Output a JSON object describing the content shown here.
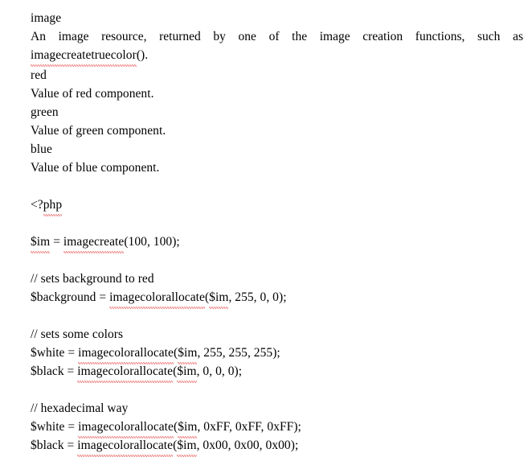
{
  "document": {
    "background_color": "#ffffff",
    "text_color": "#000000",
    "spellcheck_underline_color": "#e02020",
    "sections": {
      "params": {
        "image_term": "image",
        "image_desc_before": "An image resource, returned by one of the image creation functions, such as ",
        "image_desc_code": "imagecreatetruecolor",
        "image_desc_after": "().",
        "red_term": "red",
        "red_desc": "Value of red component.",
        "green_term": "green",
        "green_desc": "Value of green component.",
        "blue_term": "blue",
        "blue_desc": "Value of blue component."
      },
      "code": {
        "open_tag_lt": "<?",
        "open_tag_php": "php",
        "create_var": "$im",
        "create_eq": " = ",
        "create_fn": "imagecreate",
        "create_args": "(100, 100);",
        "comment_background": "// sets background to red",
        "bg_var": "$background",
        "bg_eq": " = ",
        "bg_fn": "imagecolorallocate",
        "bg_open": "(",
        "bg_im": "$im",
        "bg_args": ", 255, 0, 0);",
        "comment_colors": "// sets some colors",
        "white_var": "$white",
        "white_eq": " = ",
        "white_fn": "imagecolorallocate",
        "white_open": "(",
        "white_im": "$im",
        "white_args": ", 255, 255, 255);",
        "black_var": "$black",
        "black_eq": " = ",
        "black_fn": "imagecolorallocate",
        "black_open": "(",
        "black_im": "$im",
        "black_args": ", 0, 0, 0);",
        "comment_hex": "// hexadecimal way",
        "hexwhite_var": "$white",
        "hexwhite_eq": " = ",
        "hexwhite_fn": "imagecolorallocate",
        "hexwhite_open": "(",
        "hexwhite_im": "$im",
        "hexwhite_args": ", 0xFF, 0xFF, 0xFF);",
        "hexblack_var": "$black",
        "hexblack_eq": " = ",
        "hexblack_fn": "imagecolorallocate",
        "hexblack_open": "(",
        "hexblack_im": "$im",
        "hexblack_args": ", 0x00, 0x00, 0x00);"
      }
    }
  }
}
